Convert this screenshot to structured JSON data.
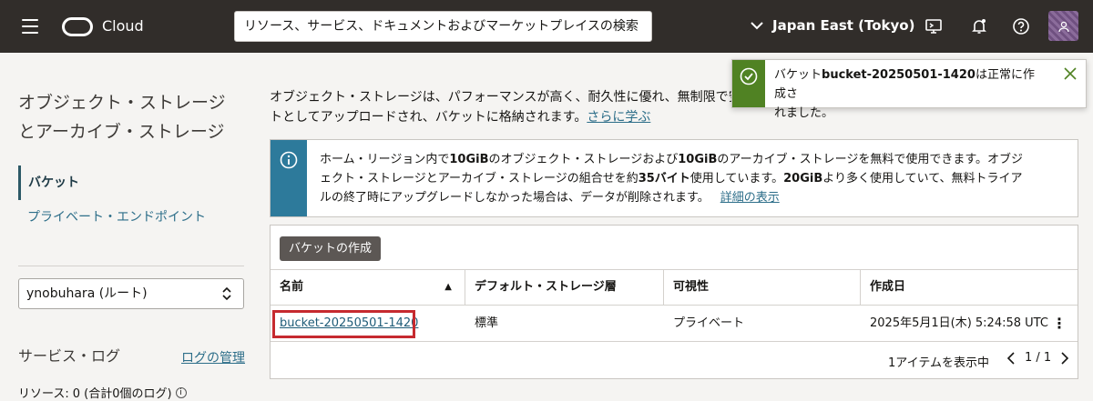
{
  "header": {
    "brand": "Cloud",
    "search_placeholder": "リソース、サービス、ドキュメントおよびマーケットプレイスの検索",
    "region": "Japan East (Tokyo)"
  },
  "sidebar": {
    "title": "オブジェクト・ストレージとアーカイブ・ストレージ",
    "items": [
      {
        "label": "バケット",
        "active": true
      },
      {
        "label": "プライベート・エンドポイント",
        "active": false
      }
    ],
    "compartment": "ynobuhara (ルート)",
    "service_log_label": "サービス・ログ",
    "log_manage_label": "ログの管理",
    "resources_label": "リソース:",
    "resources_value": "0 (合計0個のログ)"
  },
  "main": {
    "intro_text": "オブジェクト・ストレージは、パフォーマンスが高く、耐久性に優れ、無制限で安",
    "intro_text2": "トとしてアップロードされ、バケットに格納されます。",
    "intro_link": "さらに学ぶ",
    "banner": {
      "line1_a": "ホーム・リージョン内で",
      "line1_b": "10GiB",
      "line1_c": "のオブジェクト・ストレージおよび",
      "line1_d": "10GiB",
      "line1_e": "のアーカイブ・ストレージを無料で使用できます。オブジ",
      "line2_a": "ェクト・ストレージとアーカイブ・ストレージの組合せを約",
      "line2_b": "35バイト",
      "line2_c": "使用しています。",
      "line2_d": "20GiB",
      "line2_e": "より多く使用していて、無料トライア",
      "line3": "ルの終了時にアップグレードしなかった場合は、データが削除されます。",
      "link": "詳細の表示"
    },
    "create_button": "バケットの作成",
    "columns": [
      "名前",
      "デフォルト・ストレージ層",
      "可視性",
      "作成日"
    ],
    "rows": [
      {
        "name": "bucket-20250501-1420",
        "tier": "標準",
        "visibility": "プライベート",
        "created": "2025年5月1日(木) 5:24:58 UTC"
      }
    ],
    "footer_count": "1アイテムを表示中",
    "pager": "1 / 1"
  },
  "toast": {
    "prefix": "バケット",
    "bucket": "bucket-20250501-1420",
    "suffix": "は正常に作成さ",
    "line2": "れました。"
  },
  "colors": {
    "header_bg": "#312d2a",
    "info_accent": "#2d7a9b",
    "success_accent": "#508223",
    "highlight": "#c62a2f"
  }
}
